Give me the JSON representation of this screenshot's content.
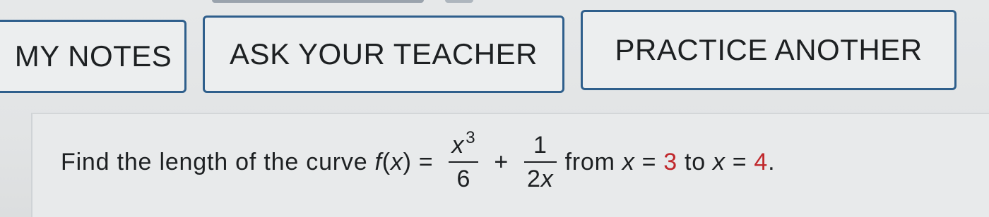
{
  "buttons": {
    "my_notes": "MY NOTES",
    "ask_teacher": "ASK YOUR TEACHER",
    "practice_another": "PRACTICE ANOTHER"
  },
  "question": {
    "prefix": "Find the length of the curve",
    "func_f": "f",
    "func_open": "(",
    "func_var": "x",
    "func_close": ")",
    "equals": "=",
    "frac1_num_var": "x",
    "frac1_num_exp": "3",
    "frac1_den": "6",
    "plus": "+",
    "frac2_num": "1",
    "frac2_den_coef": "2",
    "frac2_den_var": "x",
    "from_word": "from",
    "from_var": "x",
    "from_eq": "=",
    "from_value": "3",
    "to_word": "to",
    "to_var": "x",
    "to_eq": "=",
    "to_value": "4",
    "period": "."
  },
  "colors": {
    "button_border": "#2f5f8c",
    "value_highlight": "#c0282c",
    "text": "#1d2022"
  }
}
